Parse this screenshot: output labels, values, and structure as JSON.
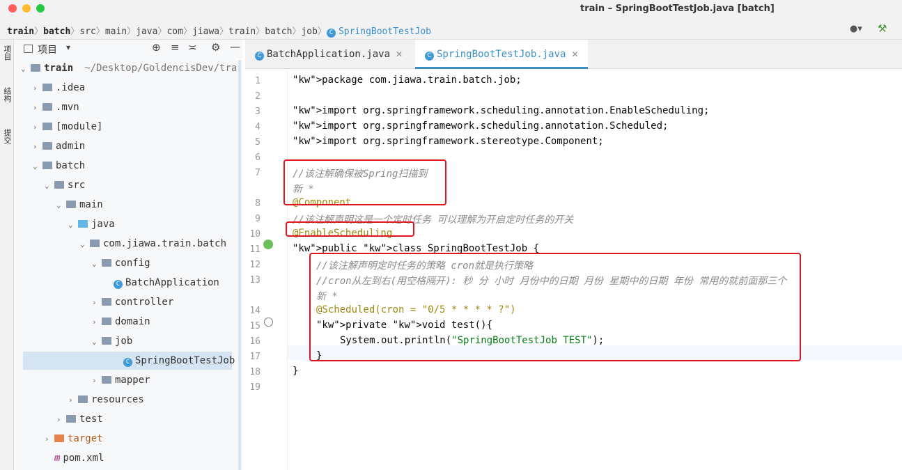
{
  "window": {
    "title": "train – SpringBootTestJob.java [batch]"
  },
  "breadcrumb": [
    "train",
    "batch",
    "src",
    "main",
    "java",
    "com",
    "jiawa",
    "train",
    "batch",
    "job",
    "SpringBootTestJob"
  ],
  "side_tabs": [
    "项目",
    "结构",
    "提交"
  ],
  "project_panel": {
    "title": "项目",
    "tree": [
      {
        "label": "train",
        "extra": "~/Desktop/GoldencisDev/tra",
        "indent": 0,
        "arrow": "⌄",
        "icon": "folder"
      },
      {
        "label": ".idea",
        "indent": 1,
        "arrow": "›",
        "icon": "folder"
      },
      {
        "label": ".mvn",
        "indent": 1,
        "arrow": "›",
        "icon": "folder"
      },
      {
        "label": "[module]",
        "indent": 1,
        "arrow": "›",
        "icon": "folder"
      },
      {
        "label": "admin",
        "indent": 1,
        "arrow": "›",
        "icon": "folder"
      },
      {
        "label": "batch",
        "indent": 1,
        "arrow": "⌄",
        "icon": "folder"
      },
      {
        "label": "src",
        "indent": 2,
        "arrow": "⌄",
        "icon": "folder"
      },
      {
        "label": "main",
        "indent": 3,
        "arrow": "⌄",
        "icon": "folder"
      },
      {
        "label": "java",
        "indent": 4,
        "arrow": "⌄",
        "icon": "folder-blue"
      },
      {
        "label": "com.jiawa.train.batch",
        "indent": 5,
        "arrow": "⌄",
        "icon": "folder"
      },
      {
        "label": "config",
        "indent": 6,
        "arrow": "⌄",
        "icon": "folder"
      },
      {
        "label": "BatchApplication",
        "indent": 7,
        "arrow": "",
        "icon": "class"
      },
      {
        "label": "controller",
        "indent": 6,
        "arrow": "›",
        "icon": "folder"
      },
      {
        "label": "domain",
        "indent": 6,
        "arrow": "›",
        "icon": "folder"
      },
      {
        "label": "job",
        "indent": 6,
        "arrow": "⌄",
        "icon": "folder"
      },
      {
        "label": "SpringBootTestJob",
        "indent": 7,
        "arrow": "",
        "icon": "class"
      },
      {
        "label": "mapper",
        "indent": 6,
        "arrow": "›",
        "icon": "folder"
      },
      {
        "label": "resources",
        "indent": 4,
        "arrow": "›",
        "icon": "folder"
      },
      {
        "label": "test",
        "indent": 3,
        "arrow": "›",
        "icon": "folder"
      },
      {
        "label": "target",
        "indent": 2,
        "arrow": "›",
        "icon": "folder-orange"
      },
      {
        "label": "pom.xml",
        "indent": 2,
        "arrow": "",
        "icon": "maven"
      }
    ]
  },
  "tabs": [
    {
      "label": "BatchApplication.java",
      "active": false
    },
    {
      "label": "SpringBootTestJob.java",
      "active": true
    }
  ],
  "code": {
    "l1": "package com.jiawa.train.batch.job;",
    "l3": "import org.springframework.scheduling.annotation.EnableScheduling;",
    "l4": "import org.springframework.scheduling.annotation.Scheduled;",
    "l5": "import org.springframework.stereotype.Component;",
    "l7": "//该注解确保被Spring扫描到",
    "l7b": "新 *",
    "l8": "@Component",
    "l9": "//该注解声明这是一个定时任务 可以理解为开启定时任务的开关",
    "l10": "@EnableScheduling",
    "l11": "public class SpringBootTestJob {",
    "l12": "//该注解声明定时任务的策略 cron就是执行策略",
    "l13": "//cron从左到右(用空格隔开): 秒 分 小时 月份中的日期 月份 星期中的日期 年份 常用的就前面那三个",
    "l13b": "新 *",
    "l14": "@Scheduled(cron = \"0/5 * * * * ?\")",
    "l15": "private void test(){",
    "l16": "System.out.println(\"SpringBootTestJob TEST\");",
    "l17": "}",
    "l18": "}"
  },
  "line_numbers": [
    "1",
    "2",
    "3",
    "4",
    "5",
    "6",
    "7",
    "8",
    "9",
    "10",
    "11",
    "12",
    "13",
    "14",
    "15",
    "16",
    "17",
    "18",
    "19"
  ]
}
